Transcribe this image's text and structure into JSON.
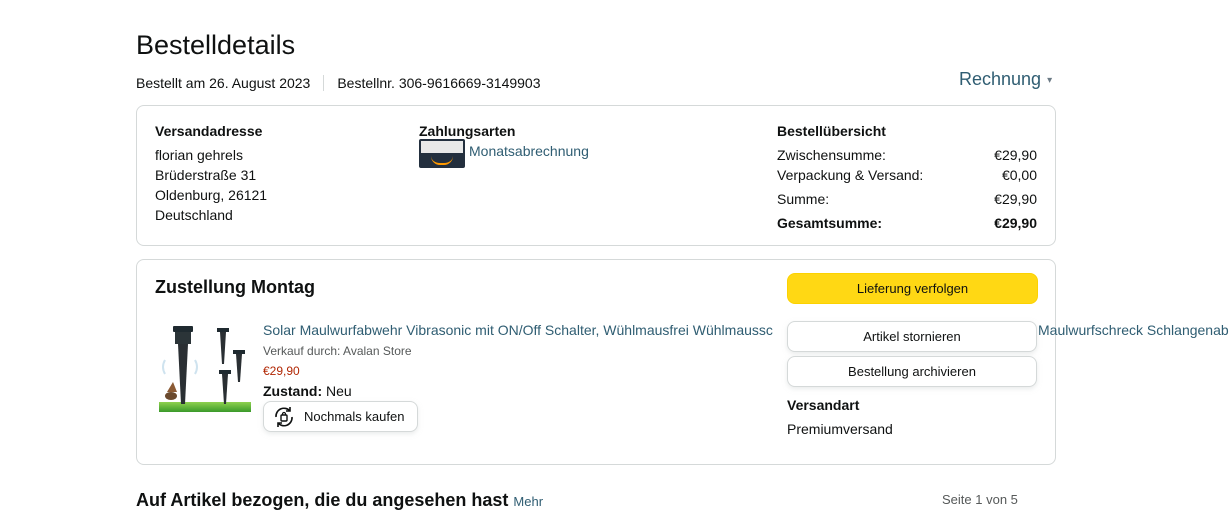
{
  "order": {
    "title": "Bestelldetails",
    "ordered_on": "Bestellt am 26. August 2023",
    "order_number": "Bestellnr. 306-9616669-3149903",
    "invoice_label": "Rechnung"
  },
  "address": {
    "title": "Versandadresse",
    "name": "florian gehrels",
    "street": "Brüderstraße 31",
    "city": "Oldenburg, 26121",
    "country": "Deutschland"
  },
  "payment": {
    "title": "Zahlungsarten",
    "method": "Monatsabrechnung"
  },
  "summary": {
    "title": "Bestellübersicht",
    "rows": [
      {
        "label": "Zwischensumme:",
        "value": "€29,90"
      },
      {
        "label": "Verpackung & Versand:",
        "value": "€0,00"
      },
      {
        "label": "Summe:",
        "value": "€29,90"
      },
      {
        "label": "Gesamtsumme:",
        "value": "€29,90"
      }
    ]
  },
  "delivery": {
    "title": "Zustellung Montag",
    "track_button": "Lieferung verfolgen",
    "cancel_button": "Artikel stornieren",
    "archive_button": "Bestellung archivieren",
    "shipping_title": "Versandart",
    "shipping_value": "Premiumversand"
  },
  "product": {
    "title": "Solar Maulwurfabwehr Vibrasonic mit ON/Off Schalter, Wühlmausfrei Wühlmaussc",
    "title_tail": "Maulwurfschreck Schlangenab",
    "seller": "Verkauf durch: Avalan Store",
    "price": "€29,90",
    "condition_label": "Zustand:",
    "condition_value": "Neu",
    "rebuy_button": "Nochmals kaufen"
  },
  "bottom": {
    "heading": "Auf Artikel bezogen, die du angesehen hast",
    "more": "Mehr",
    "pager": "Seite 1 von 5"
  },
  "colors": {
    "link": "#2f5d72",
    "price": "#b12704",
    "primary_button": "#ffd814"
  }
}
